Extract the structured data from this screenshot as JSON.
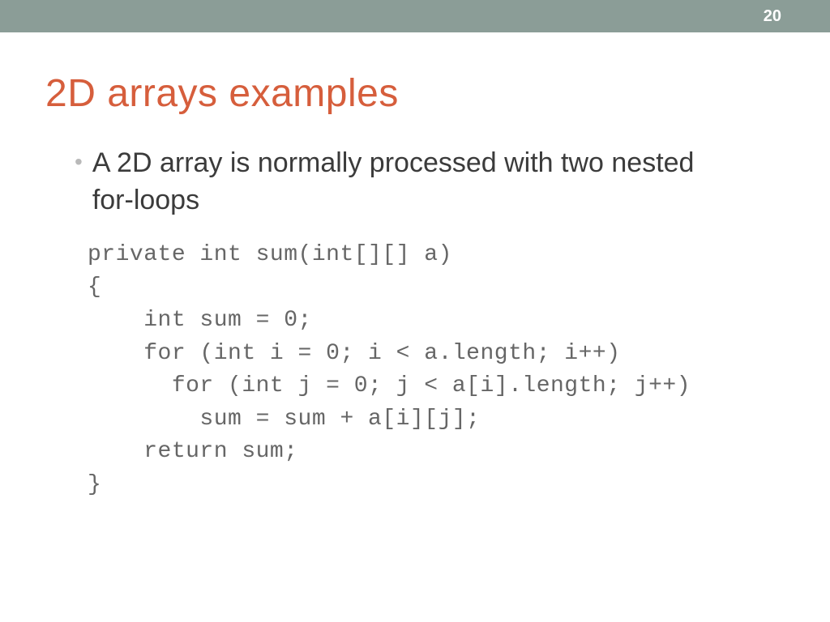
{
  "header": {
    "slideNumber": "20"
  },
  "slide": {
    "title": "2D arrays examples",
    "bullet": "A 2D array is normally processed with two nested for-loops",
    "code": "private int sum(int[][] a)\n{\n    int sum = 0;\n    for (int i = 0; i < a.length; i++)\n      for (int j = 0; j < a[i].length; j++)\n        sum = sum + a[i][j];\n    return sum;\n}"
  }
}
